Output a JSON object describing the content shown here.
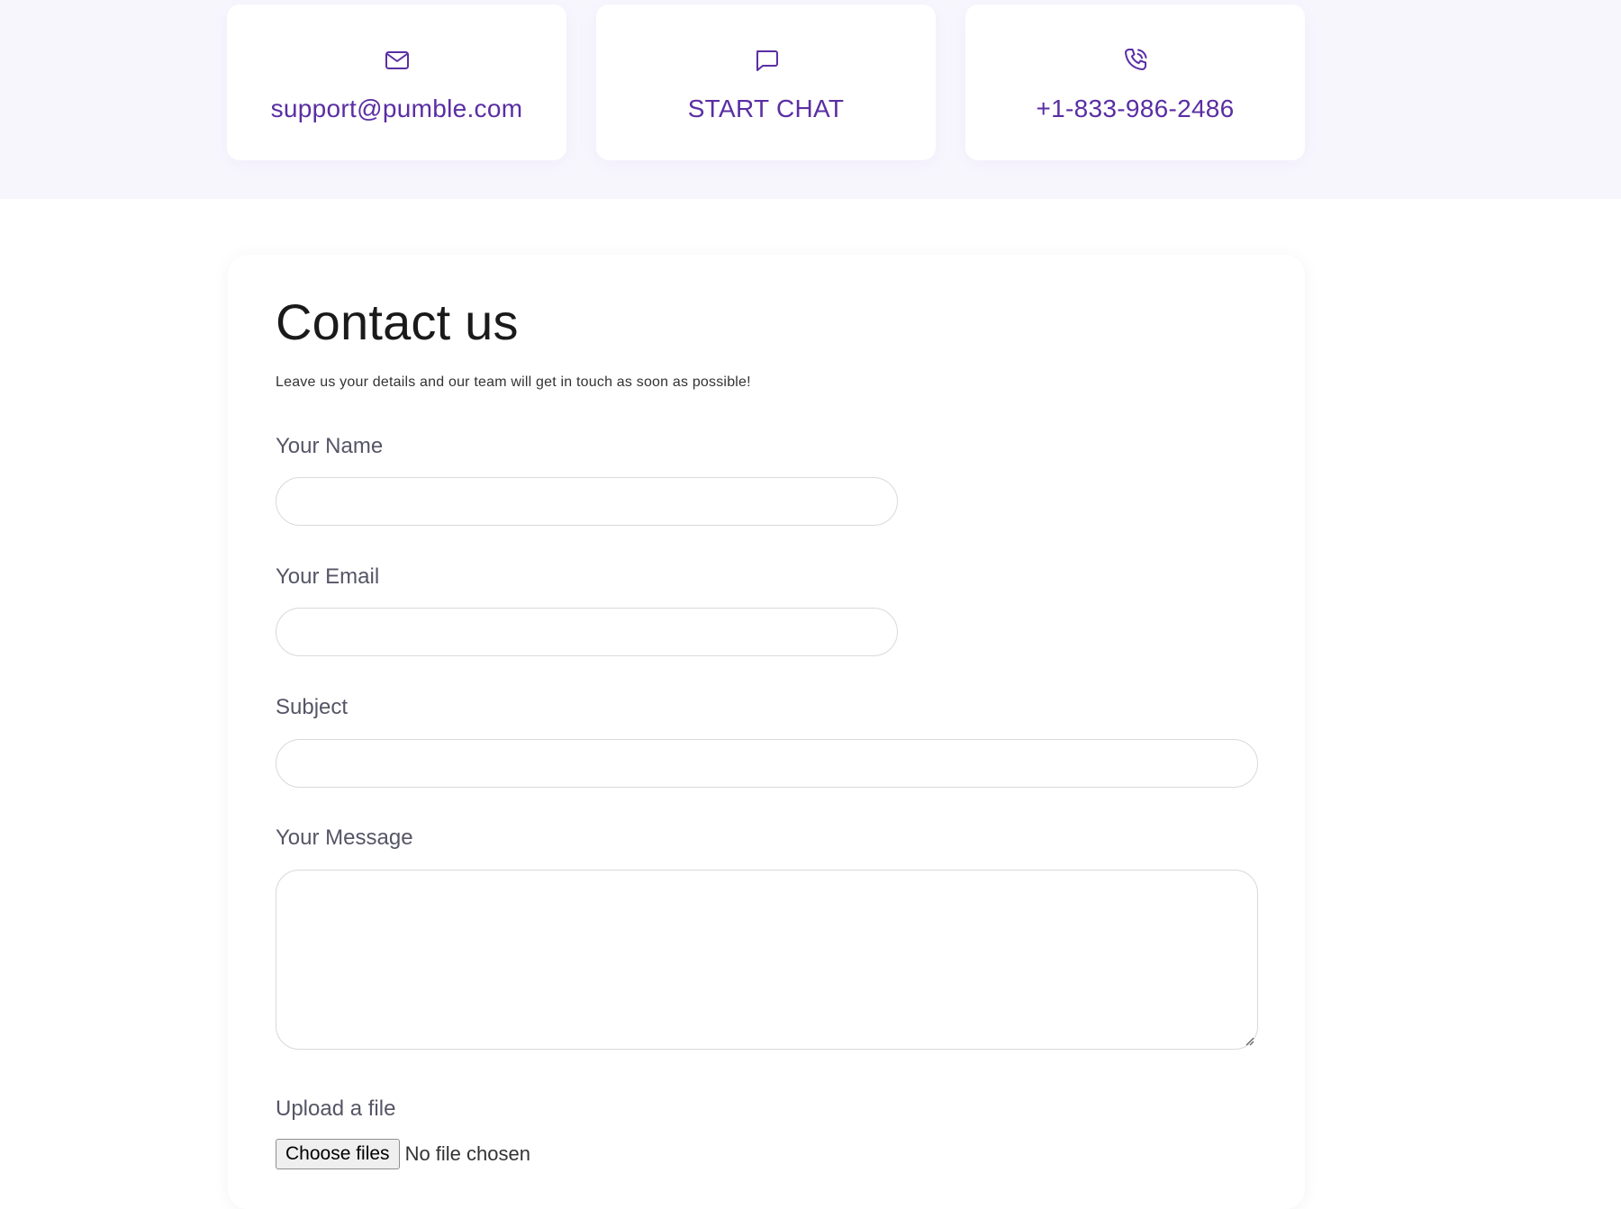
{
  "contact_cards": {
    "email": {
      "label": "support@pumble.com",
      "icon": "mail-icon"
    },
    "chat": {
      "label": "START CHAT",
      "icon": "chat-bubble-icon"
    },
    "phone": {
      "label": "+1-833-986-2486",
      "icon": "phone-call-icon"
    }
  },
  "form": {
    "title": "Contact us",
    "subtitle": "Leave us your details and our team will get in touch as soon as possible!",
    "fields": {
      "name": {
        "label": "Your Name",
        "value": "",
        "placeholder": ""
      },
      "email": {
        "label": "Your Email",
        "value": "",
        "placeholder": ""
      },
      "subject": {
        "label": "Subject",
        "value": "",
        "placeholder": ""
      },
      "message": {
        "label": "Your Message",
        "value": "",
        "placeholder": ""
      }
    },
    "upload": {
      "label": "Upload a file",
      "button_label": "Choose files",
      "status": "No file chosen"
    }
  },
  "colors": {
    "accent": "#5a2ea3",
    "band_background": "#f8f6fd",
    "input_border": "#d9d9de",
    "label_text": "#555566"
  }
}
